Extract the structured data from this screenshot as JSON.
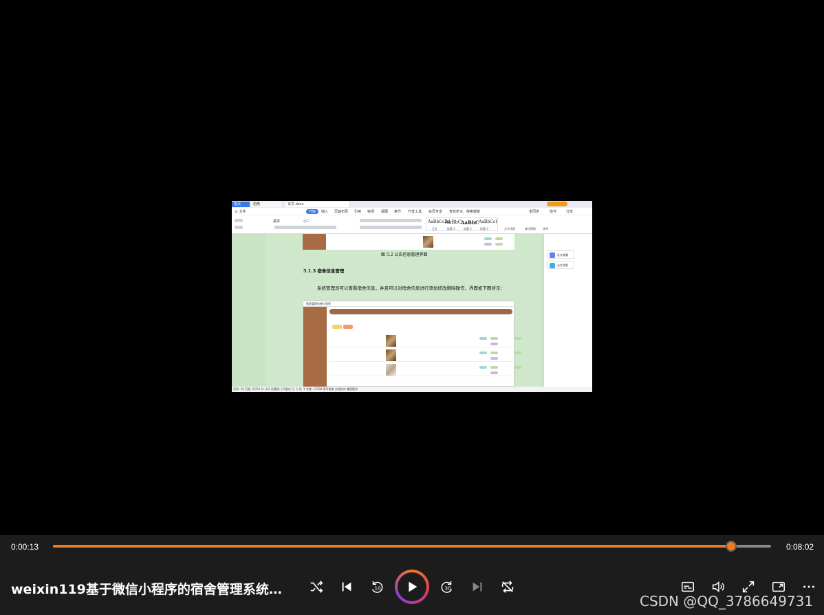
{
  "player": {
    "current_time": "0:00:13",
    "duration": "0:08:02",
    "progress_fraction": 0.944,
    "title": "weixin119基于微信小程序的宿舍管理系统含...",
    "watermark": "CSDN @QQ_3786649731",
    "accent_color": "#f07a23"
  },
  "document": {
    "tabs": [
      "首页",
      "稻壳",
      "论文.docx"
    ],
    "menu": [
      "三 文件",
      "开始",
      "插入",
      "页面布局",
      "引用",
      "审阅",
      "视图",
      "章节",
      "开发工具",
      "会员专享",
      "查找命令、搜索模板"
    ],
    "active_menu": "开始",
    "ribbon_font": "黑体",
    "ribbon_size": "小二",
    "styles": [
      {
        "preview": "AaBbCcDd",
        "name": "正文"
      },
      {
        "preview": "AaBbC",
        "name": "标题 1"
      },
      {
        "preview": "AaBbC",
        "name": "标题 2"
      },
      {
        "preview": "AaBbCcI",
        "name": "标题 3"
      }
    ],
    "ribbon_right": [
      "文字排版",
      "查找替换",
      "选择"
    ],
    "top_right": [
      "未同步",
      "协作",
      "分享"
    ],
    "side_panel": [
      "论文查重",
      "论文排版"
    ],
    "caption": "图 5.2  公告信息管理界面",
    "heading": "5.1.3  宿舍信息管理",
    "paragraph": "系统管理员可以查看宿舍信息，并且可以对宿舍信息进行添加修改删除操作，界面如下图所示：",
    "shot_title": "宿舍管理系统小程序",
    "status_bar": "页码: 19   页面: 23/34   节: 2/2   设置值: 2.5厘米   行: 1   列: 1   字数: 11538   拼写检查   文档校对   兼容模式"
  }
}
